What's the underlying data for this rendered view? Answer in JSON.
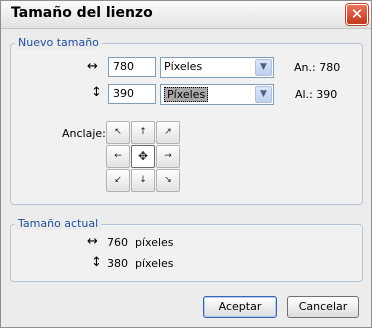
{
  "window": {
    "title": "Tamaño del lienzo",
    "close_glyph": "✕"
  },
  "new_size": {
    "legend": "Nuevo tamaño",
    "width_icon": "↔",
    "height_icon": "↕",
    "width_value": "780",
    "height_value": "390",
    "width_unit": "Píxeles",
    "height_unit": "Píxeles",
    "dropdown_glyph": "▼",
    "width_readout": "An.: 780",
    "height_readout": "Al.: 390",
    "anchor_label": "Anclaje:",
    "anchor_glyphs": [
      "↖",
      "↑",
      "↗",
      "←",
      "✥",
      "→",
      "↙",
      "↓",
      "↘"
    ]
  },
  "current_size": {
    "legend": "Tamaño actual",
    "width_icon": "↔",
    "height_icon": "↕",
    "width": "760  píxeles",
    "height": "380  píxeles"
  },
  "buttons": {
    "ok": "Aceptar",
    "cancel": "Cancelar"
  }
}
